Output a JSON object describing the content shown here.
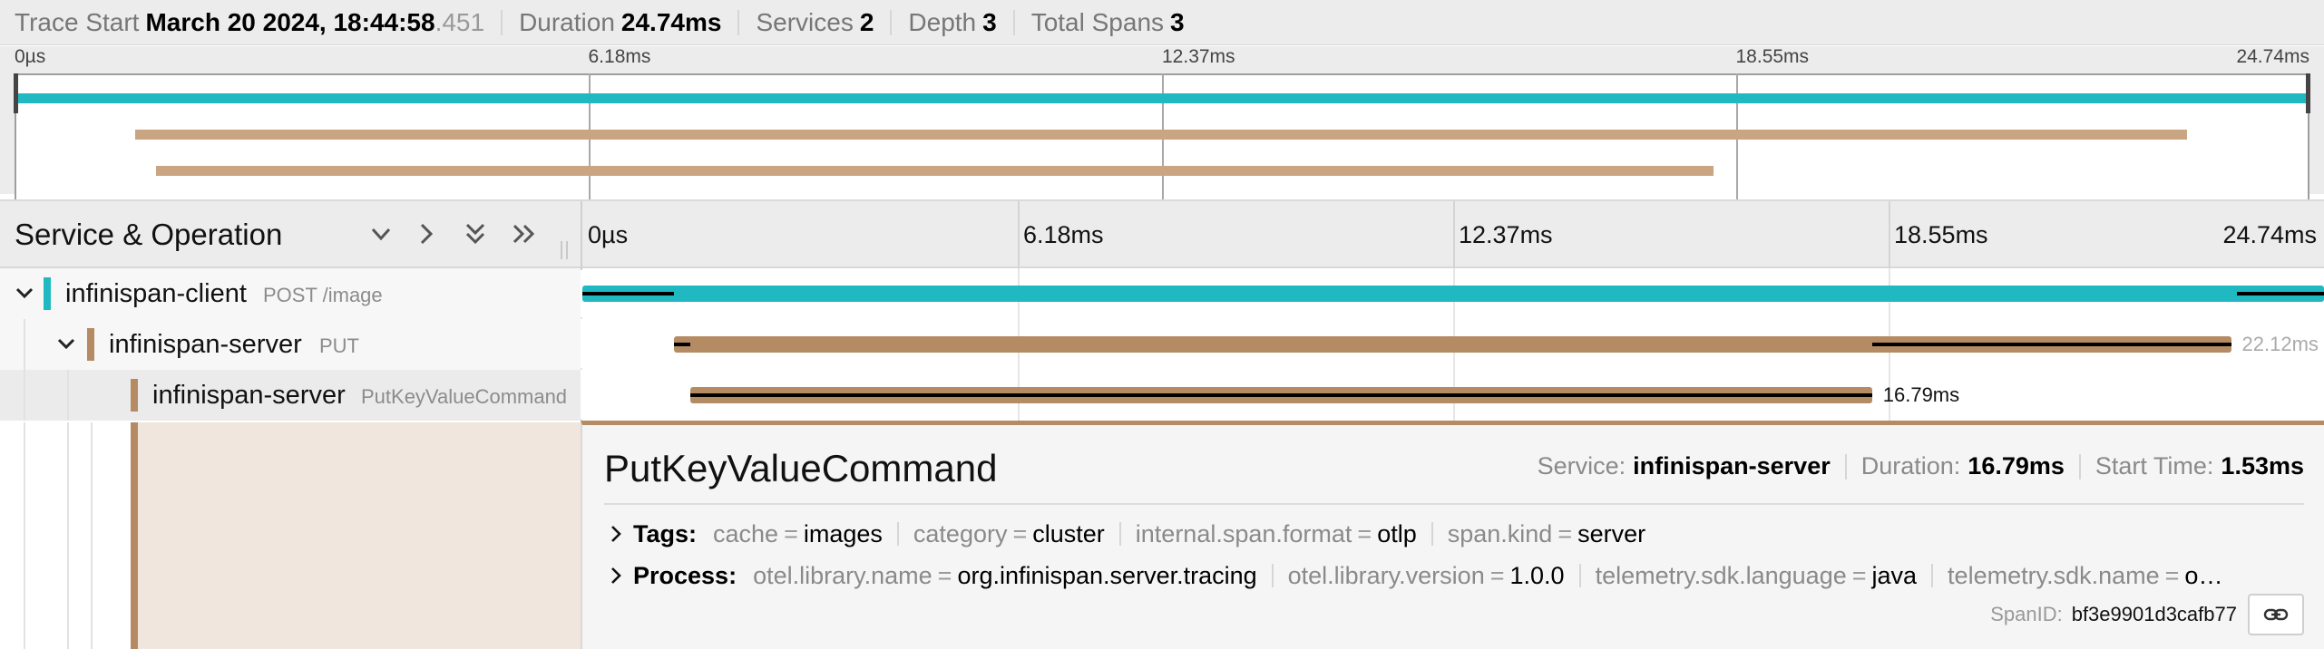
{
  "trace_header": {
    "start_label": "Trace Start",
    "start_value": "March 20 2024, 18:44:58",
    "start_ms": ".451",
    "duration_label": "Duration",
    "duration_value": "24.74ms",
    "services_label": "Services",
    "services_value": "2",
    "depth_label": "Depth",
    "depth_value": "3",
    "total_spans_label": "Total Spans",
    "total_spans_value": "3"
  },
  "minimap": {
    "ticks": [
      "0µs",
      "6.18ms",
      "12.37ms",
      "18.55ms",
      "24.74ms"
    ]
  },
  "timeline_header": {
    "title": "Service & Operation",
    "ticks": [
      "0µs",
      "6.18ms",
      "12.37ms",
      "18.55ms",
      "24.74ms"
    ],
    "buttons": [
      "collapse-one",
      "expand-one",
      "collapse-all",
      "expand-all"
    ]
  },
  "trace_duration_ms": 24.74,
  "colors": {
    "client": "#20b9c2",
    "server": "#b58b63",
    "server_minimap": "#c9a582",
    "critical_path": "#000000"
  },
  "spans": [
    {
      "service": "infinispan-client",
      "operation": "POST /image",
      "depth": 0,
      "start_ms": 0,
      "duration_ms": 24.74,
      "duration_label": "",
      "color": "#20b9c2",
      "expanded": true,
      "critical_path": [
        [
          0,
          1.3
        ],
        [
          23.5,
          24.74
        ]
      ]
    },
    {
      "service": "infinispan-server",
      "operation": "PUT",
      "depth": 1,
      "start_ms": 1.3,
      "duration_ms": 22.12,
      "duration_label": "22.12ms",
      "color": "#b58b63",
      "expanded": true,
      "critical_path": [
        [
          1.3,
          1.53
        ],
        [
          18.32,
          23.42
        ]
      ]
    },
    {
      "service": "infinispan-server",
      "operation": "PutKeyValueCommand",
      "depth": 2,
      "start_ms": 1.53,
      "duration_ms": 16.79,
      "duration_label": "16.79ms",
      "color": "#b58b63",
      "expanded": false,
      "critical_path": [
        [
          1.53,
          18.32
        ]
      ]
    }
  ],
  "detail": {
    "operation": "PutKeyValueCommand",
    "service_label": "Service:",
    "service_value": "infinispan-server",
    "duration_label": "Duration:",
    "duration_value": "16.79ms",
    "start_label": "Start Time:",
    "start_value": "1.53ms",
    "tags_label": "Tags:",
    "tags": [
      {
        "key": "cache",
        "value": "images"
      },
      {
        "key": "category",
        "value": "cluster"
      },
      {
        "key": "internal.span.format",
        "value": "otlp"
      },
      {
        "key": "span.kind",
        "value": "server"
      }
    ],
    "process_label": "Process:",
    "process": [
      {
        "key": "otel.library.name",
        "value": "org.infinispan.server.tracing"
      },
      {
        "key": "otel.library.version",
        "value": "1.0.0"
      },
      {
        "key": "telemetry.sdk.language",
        "value": "java"
      },
      {
        "key": "telemetry.sdk.name",
        "value": "o…"
      }
    ],
    "spanid_label": "SpanID:",
    "spanid_value": "bf3e9901d3cafb77"
  }
}
